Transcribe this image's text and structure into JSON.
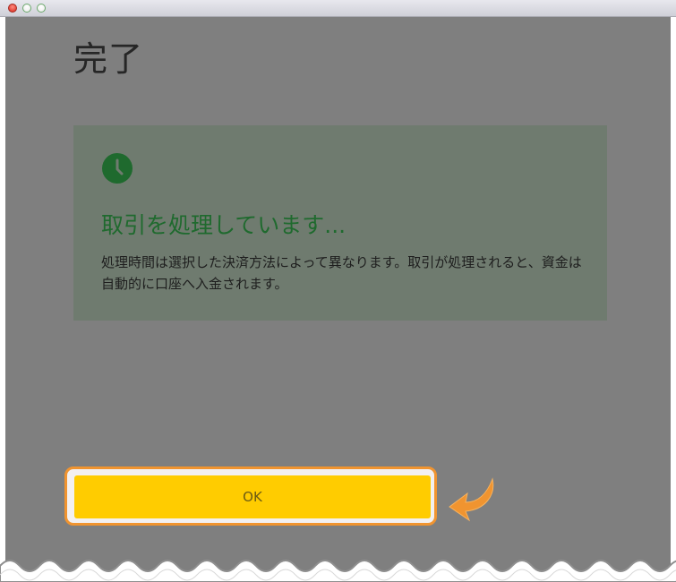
{
  "window": {
    "controls": [
      "close",
      "minimize",
      "zoom"
    ]
  },
  "page": {
    "title": "完了"
  },
  "status": {
    "icon": "clock-icon",
    "heading": "取引を処理しています...",
    "description": "処理時間は選択した決済方法によって異なります。取引が処理されると、資金は自動的に口座へ入金されます。"
  },
  "actions": {
    "ok_label": "OK"
  },
  "colors": {
    "overlay": "#7f7f7f",
    "card_background": "#6f7b6f",
    "accent_green": "#1f6a2e",
    "button_yellow": "#ffcc00",
    "highlight_orange": "#f09430"
  }
}
